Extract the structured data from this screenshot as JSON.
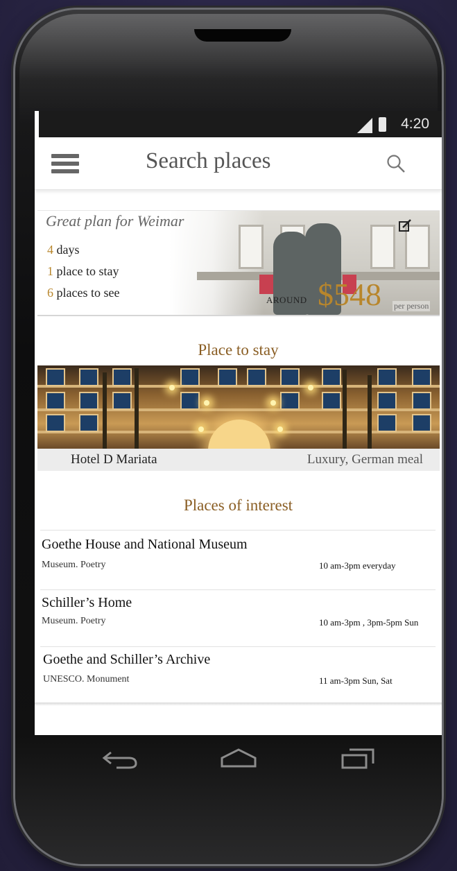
{
  "status_bar": {
    "time": "4:20",
    "icons": [
      "signal-icon",
      "battery-icon"
    ]
  },
  "app_bar": {
    "title": "Search places",
    "icons": [
      "menu-icon",
      "search-icon"
    ]
  },
  "plan": {
    "heading": "Great plan for Weimar",
    "days_num": "4",
    "days_text": " days",
    "stay_num": "1",
    "stay_text": " place to stay",
    "see_num": "6",
    "see_text": " places to see",
    "around_label": "AROUND",
    "price": "$548",
    "per_person": "per person",
    "edit_icon": "edit-icon"
  },
  "stay": {
    "title": "Place to stay",
    "hotel_name": "Hotel D Mariata",
    "hotel_tags": "Luxury, German meal"
  },
  "interest": {
    "title": "Places of interest",
    "items": [
      {
        "name": "Goethe House and National Museum",
        "category": "Museum. Poetry",
        "hours": "10 am-3pm everyday"
      },
      {
        "name": "Schiller’s Home",
        "category": "Museum. Poetry",
        "hours": "10 am-3pm , 3pm-5pm Sun"
      },
      {
        "name": "Goethe and Schiller’s Archive",
        "category": "UNESCO. Monument",
        "hours": "11 am-3pm Sun, Sat"
      }
    ]
  },
  "nav_bar": {
    "icons": [
      "back-icon",
      "home-icon",
      "recent-apps-icon"
    ]
  },
  "colors": {
    "accent": "#b8862c",
    "section_title": "#8a5e24",
    "status_bar": "#1b1b1b"
  }
}
